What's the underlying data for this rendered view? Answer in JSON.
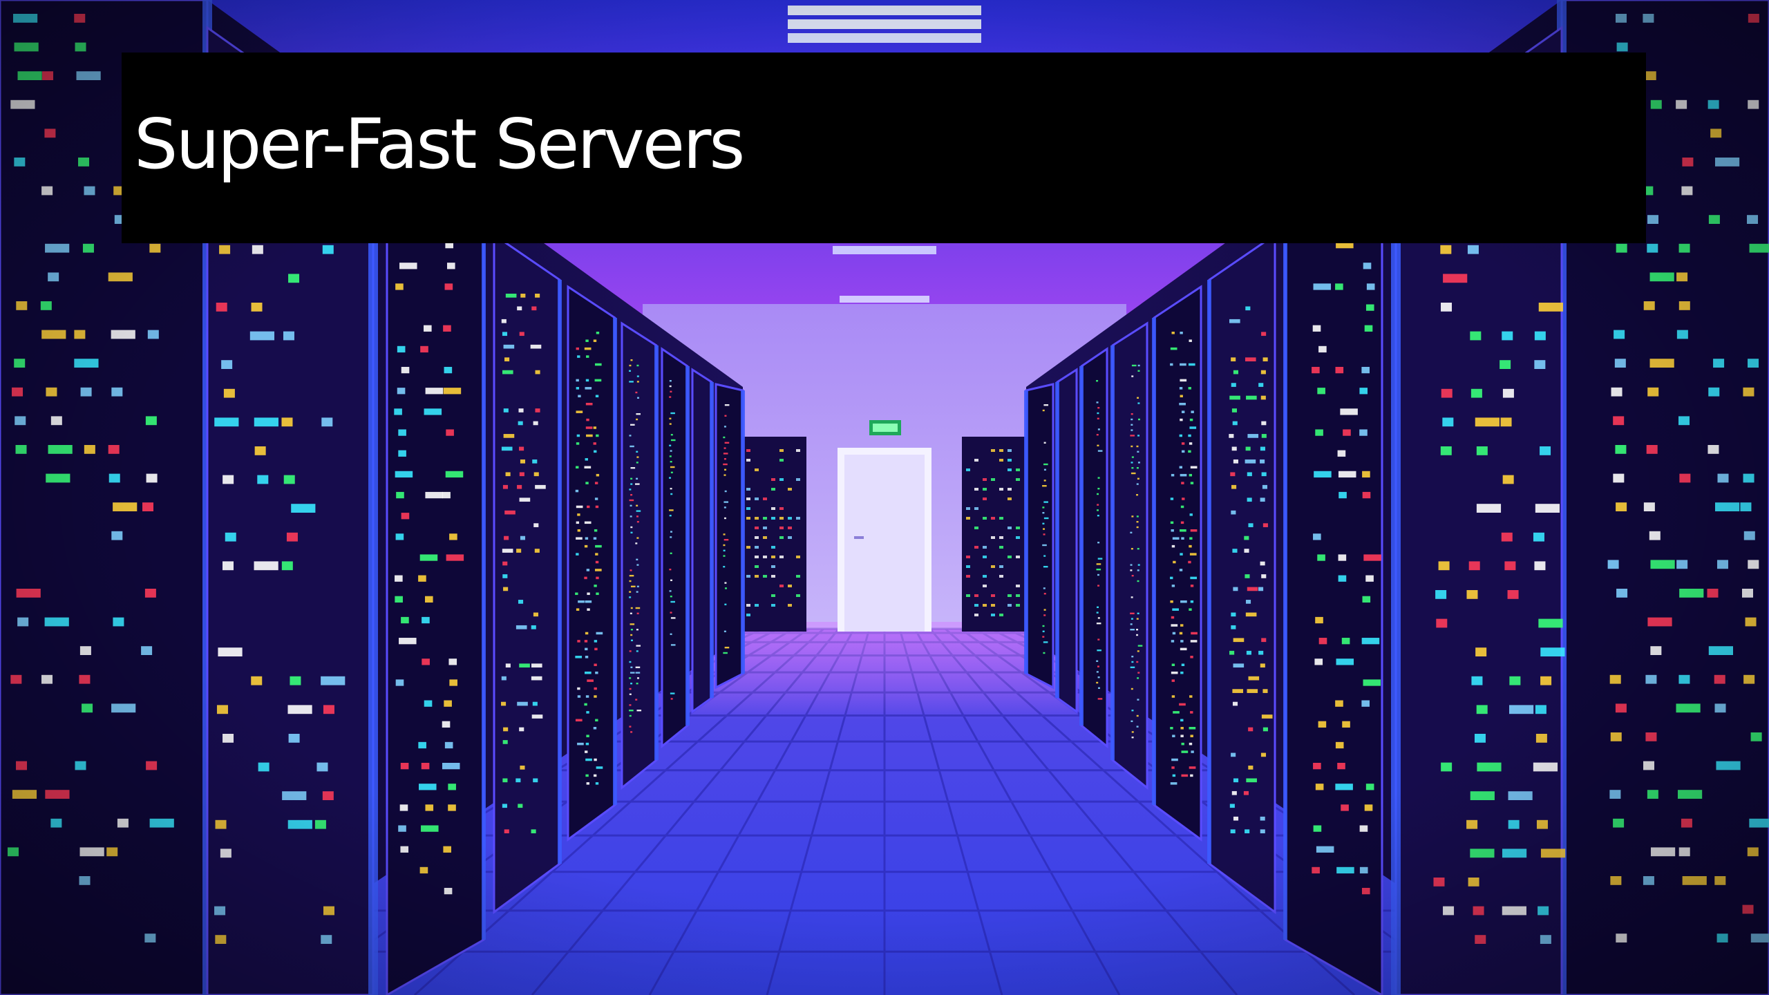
{
  "slide": {
    "title": "Super-Fast Servers"
  },
  "scene": {
    "subject": "server-room-corridor",
    "exit_sign_icon": "exit-sign-icon",
    "colors": {
      "dominant_blue": "#2f2bd8",
      "violet": "#8a3cf0",
      "far_wall": "#b9a6f5",
      "door": "#e9e6ff",
      "floor_dark": "#1b1a8c",
      "floor_light": "#5a63f0",
      "led_yellow": "#ffd23a",
      "led_cyan": "#38e8ff",
      "led_green": "#39ff7a",
      "led_red": "#ff3b5a",
      "banner": "#000000",
      "title_text": "#ffffff"
    }
  }
}
